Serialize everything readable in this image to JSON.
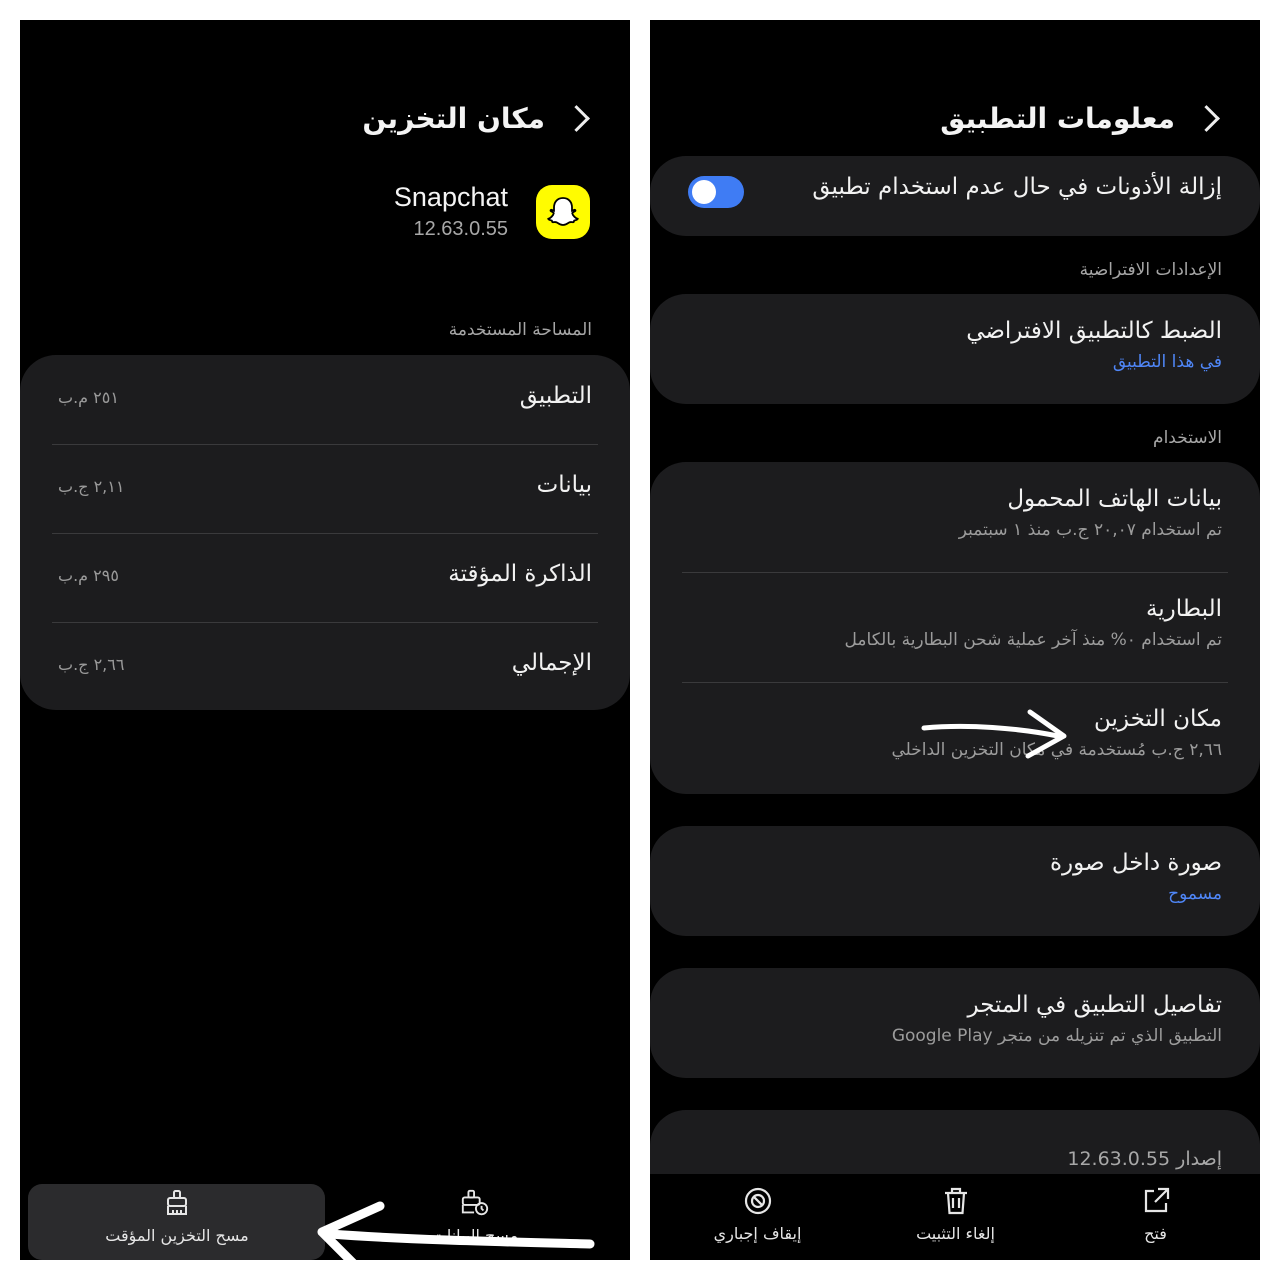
{
  "left": {
    "title": "مكان التخزين",
    "app": {
      "name": "Snapchat",
      "version": "12.63.0.55"
    },
    "section_label": "المساحة المستخدمة",
    "rows": [
      {
        "label": "التطبيق",
        "value": "٢٥١ م.ب"
      },
      {
        "label": "بيانات",
        "value": "٢,١١ ج.ب"
      },
      {
        "label": "الذاكرة المؤقتة",
        "value": "٢٩٥ م.ب"
      },
      {
        "label": "الإجمالي",
        "value": "٢,٦٦ ج.ب"
      }
    ],
    "bottom": {
      "clear_cache": "مسح التخزين المؤقت",
      "clear_data": "مسح البيانات"
    }
  },
  "right": {
    "title": "معلومات التطبيق",
    "remove_permissions": {
      "label": "إزالة الأذونات في حال عدم استخدام تطبيق",
      "enabled": true
    },
    "defaults_label": "الإعدادات الافتراضية",
    "set_default": {
      "title": "الضبط كالتطبيق الافتراضي",
      "sub": "في هذا التطبيق"
    },
    "usage_label": "الاستخدام",
    "mobile_data": {
      "title": "بيانات الهاتف المحمول",
      "sub": "تم استخدام ٢٠,٠٧ ج.ب منذ ١ سبتمبر"
    },
    "battery": {
      "title": "البطارية",
      "sub": "تم استخدام ٠% منذ آخر عملية شحن البطارية بالكامل"
    },
    "storage": {
      "title": "مكان التخزين",
      "sub": "٢,٦٦ ج.ب مُستخدمة في مكان التخزين الداخلي"
    },
    "pip": {
      "title": "صورة داخل صورة",
      "sub": "مسموح"
    },
    "store": {
      "title": "تفاصيل التطبيق في المتجر",
      "sub": "التطبيق الذي تم تنزيله من متجر Google Play"
    },
    "version": "إصدار 12.63.0.55",
    "bottom": {
      "open": "فتح",
      "uninstall": "إلغاء التثبيت",
      "force_stop": "إيقاف إجباري"
    }
  },
  "colors": {
    "accent": "#3f7cf4",
    "link": "#4f86f7",
    "snap_yellow": "#fffc00",
    "card": "#1c1c1e"
  }
}
